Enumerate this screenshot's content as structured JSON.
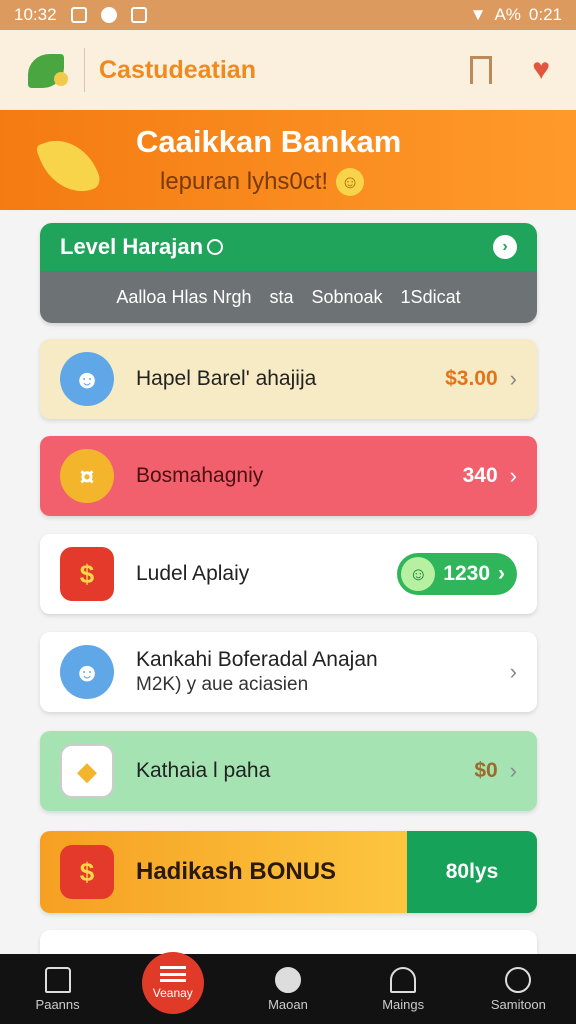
{
  "status": {
    "time_left": "10:32",
    "battery": "A%",
    "time_right": "0:21"
  },
  "app": {
    "title": "Castudeatian"
  },
  "banner": {
    "title": "Caaikkan Bankam",
    "subtitle": "lepuran lyhs0ct!"
  },
  "level": {
    "title": "Level Harajan",
    "stats": [
      "Aalloa Hlas Nrgh",
      "sta",
      "Sobnoak",
      "1Sdicat"
    ]
  },
  "cards": [
    {
      "label": "Hapel Barel' ahajija",
      "value": "$3.00"
    },
    {
      "label": "Bosmahagniy",
      "value": "340"
    },
    {
      "label": "Ludel Aplaiy",
      "value": "1230"
    },
    {
      "label": "Kankahi Boferadal Anajan",
      "sub": "M2K) y aue aciasien"
    },
    {
      "label": "Kathaia l paha",
      "value": "$0"
    },
    {
      "label": "Hadikash BONUS",
      "value": "80lys"
    }
  ],
  "tabs": [
    "Paanns",
    "Veanay",
    "Maoan",
    "Maings",
    "Samitoon"
  ],
  "colors": {
    "primary": "#f47b12",
    "green": "#20a45c",
    "red": "#f2606e"
  }
}
